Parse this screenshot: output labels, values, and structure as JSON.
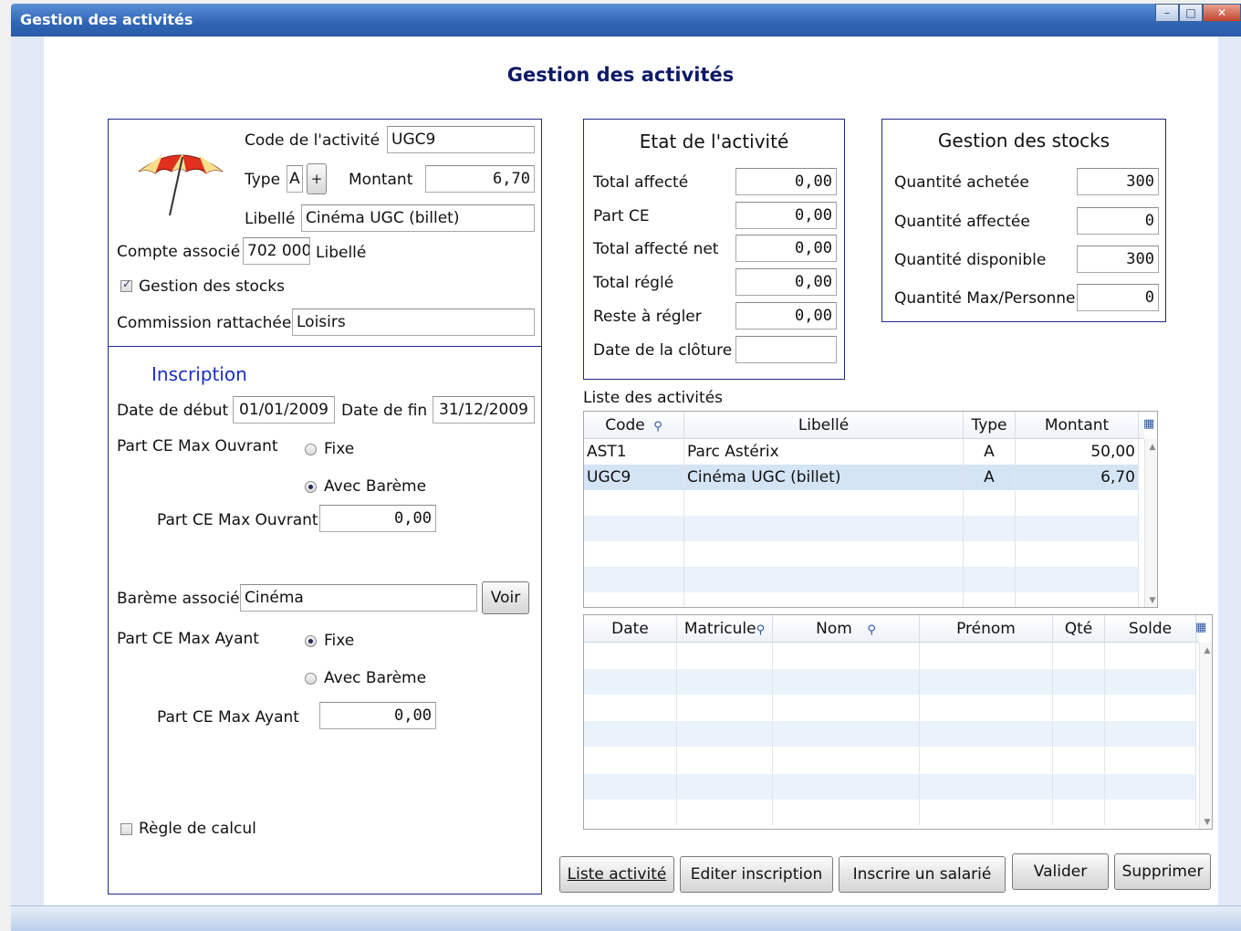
{
  "window": {
    "title": "Gestion des activités"
  },
  "page": {
    "title": "Gestion des activités"
  },
  "activity": {
    "code_label": "Code de l'activité",
    "code_value": "UGC9",
    "type_label": "Type",
    "type_value": "A",
    "plus_label": "+",
    "montant_label": "Montant",
    "montant_value": "6,70",
    "libelle_label": "Libellé",
    "libelle_value": "Cinéma UGC (billet)",
    "compte_label": "Compte associé",
    "compte_value": "702 000",
    "compte_libelle_label": "Libellé",
    "stock_checkbox_label": "Gestion des stocks",
    "stock_checked": true,
    "commission_label": "Commission rattachée",
    "commission_value": "Loisirs"
  },
  "inscription": {
    "title": "Inscription",
    "date_debut_label": "Date de début",
    "date_debut_value": "01/01/2009",
    "date_fin_label": "Date de fin",
    "date_fin_value": "31/12/2009",
    "ouvrant_label": "Part CE Max Ouvrant",
    "fixe_label": "Fixe",
    "bareme_label": "Avec Barème",
    "ouvrant_amount_label": "Part CE Max Ouvrant",
    "ouvrant_amount_value": "0,00",
    "bareme_assoc_label": "Barème associé",
    "bareme_assoc_value": "Cinéma",
    "voir_label": "Voir",
    "ayant_label": "Part CE Max Ayant",
    "ayant_amount_label": "Part CE Max Ayant",
    "ayant_amount_value": "0,00",
    "regle_label": "Règle de calcul"
  },
  "etat": {
    "title": "Etat de l'activité",
    "rows": [
      {
        "label": "Total affecté",
        "value": "0,00"
      },
      {
        "label": "Part CE",
        "value": "0,00"
      },
      {
        "label": "Total affecté net",
        "value": "0,00"
      },
      {
        "label": "Total réglé",
        "value": "0,00"
      },
      {
        "label": "Reste à régler",
        "value": "0,00"
      },
      {
        "label": "Date de la clôture",
        "value": ""
      }
    ]
  },
  "stocks": {
    "title": "Gestion des stocks",
    "rows": [
      {
        "label": "Quantité achetée",
        "value": "300"
      },
      {
        "label": "Quantité affectée",
        "value": "0"
      },
      {
        "label": "Quantité disponible",
        "value": "300"
      },
      {
        "label": "Quantité Max/Personne",
        "value": "0"
      }
    ]
  },
  "liste": {
    "title": "Liste des activités",
    "columns": [
      "Code",
      "Libellé",
      "Type",
      "Montant"
    ],
    "rows": [
      {
        "code": "AST1",
        "libelle": "Parc Astérix",
        "type": "A",
        "montant": "50,00"
      },
      {
        "code": "UGC9",
        "libelle": "Cinéma UGC (billet)",
        "type": "A",
        "montant": "6,70"
      }
    ]
  },
  "inscrits": {
    "columns": [
      "Date",
      "Matricule",
      "Nom",
      "Prénom",
      "Qté",
      "Solde"
    ]
  },
  "buttons": {
    "liste_activite": "Liste activité",
    "editer_inscription": "Editer inscription",
    "inscrire_salarie": "Inscrire un salarié",
    "valider": "Valider",
    "supprimer": "Supprimer"
  },
  "colors": {
    "title_bar": "#2f65b5",
    "frame_border": "#1f2a8c",
    "heading": "#0d1a66",
    "selected_row": "#d5e4f5",
    "alt_row": "#eaf2fb"
  },
  "icons": {
    "activity_logo": "umbrella-icon"
  }
}
